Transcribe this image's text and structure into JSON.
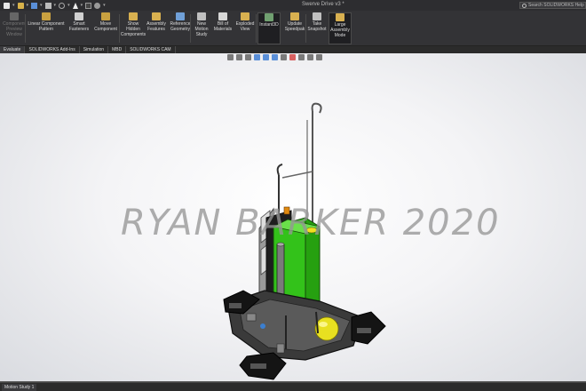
{
  "window": {
    "title": "Swerve Drive v3 *",
    "search_placeholder": "Search SOLIDWORKS Help"
  },
  "ribbon": {
    "buttons": [
      {
        "label": "Component Preview Window",
        "icon": "preview-window-icon",
        "color": "#666666",
        "dim": true
      },
      {
        "label": "Linear Component Pattern",
        "icon": "linear-pattern-icon",
        "color": "#c8a040"
      },
      {
        "label": "Smart Fasteners",
        "icon": "smart-fasteners-icon",
        "color": "#d0d0d0"
      },
      {
        "label": "Move Component",
        "icon": "move-component-icon",
        "color": "#c8a040"
      },
      {
        "label": "Show Hidden Components",
        "icon": "show-hidden-icon",
        "color": "#d8b050"
      },
      {
        "label": "Assembly Features",
        "icon": "assembly-features-icon",
        "color": "#d8b050"
      },
      {
        "label": "Reference Geometry",
        "icon": "reference-geometry-icon",
        "color": "#70a0d8"
      },
      {
        "label": "New Motion Study",
        "icon": "motion-study-icon",
        "color": "#c0c0c0"
      },
      {
        "label": "Bill of Materials",
        "icon": "bill-of-materials-icon",
        "color": "#d8d8d8"
      },
      {
        "label": "Exploded View",
        "icon": "exploded-view-icon",
        "color": "#d8b050"
      },
      {
        "label": "Instant3D",
        "icon": "instant3d-icon",
        "color": "#70a070",
        "active": true
      },
      {
        "label": "Update Speedpak",
        "icon": "speedpak-icon",
        "color": "#d8b050"
      },
      {
        "label": "Take Snapshot",
        "icon": "snapshot-icon",
        "color": "#c0c0c0"
      },
      {
        "label": "Large Assembly Mode",
        "icon": "large-assembly-icon",
        "color": "#d8b050",
        "active": true
      }
    ]
  },
  "tabs": [
    "Evaluate",
    "SOLIDWORKS Add-Ins",
    "Simulation",
    "MBD",
    "SOLIDWORKS CAM"
  ],
  "viewport": {
    "watermark": "RYAN BARKER 2020",
    "hud_icons": [
      "zoom-fit-icon",
      "zoom-area-icon",
      "previous-view-icon",
      "section-view-icon",
      "view-orientation-icon",
      "display-style-icon",
      "hide-show-icon",
      "edit-appearance-icon",
      "scene-icon",
      "view-settings-icon",
      "display-icon"
    ]
  },
  "status": {
    "motion_tab": "Motion Study 1"
  },
  "colors": {
    "chrome": "#2d2d30",
    "ribbon": "#333336",
    "accent_green": "#33c21a",
    "ball_yellow": "#e8e020"
  }
}
